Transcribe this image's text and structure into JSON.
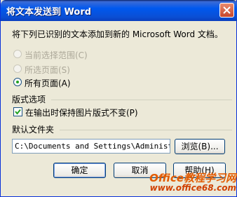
{
  "window": {
    "title": "将文本发送到 Word"
  },
  "instruction": "将下列已识别的文本添加到新的 Microsoft Word 文档。",
  "page_range": [
    {
      "label": "当前选择范围(C)",
      "enabled": false,
      "selected": false
    },
    {
      "label": "所选页面(S)",
      "enabled": false,
      "selected": false
    },
    {
      "label": "所有页面(A)",
      "enabled": true,
      "selected": true
    }
  ],
  "layout_group": {
    "label": "版式选项",
    "keep_layout_label": "在输出时保持图片版式不变(P)",
    "keep_layout_checked": true
  },
  "folder_group": {
    "label": "默认文件夹",
    "path_value": "C:\\Documents and Settings\\Administra",
    "browse_label": "浏览(B)..."
  },
  "buttons": {
    "ok": "确定",
    "cancel": "取消",
    "help": "帮助(H)"
  },
  "watermark": {
    "line1": "Office教程学习网",
    "line2": "www.office68.com"
  },
  "colors": {
    "title_bar": "#0058ee",
    "dialog_bg": "#ece9d8",
    "close": "#c7462b",
    "watermark": "#e35b00"
  }
}
